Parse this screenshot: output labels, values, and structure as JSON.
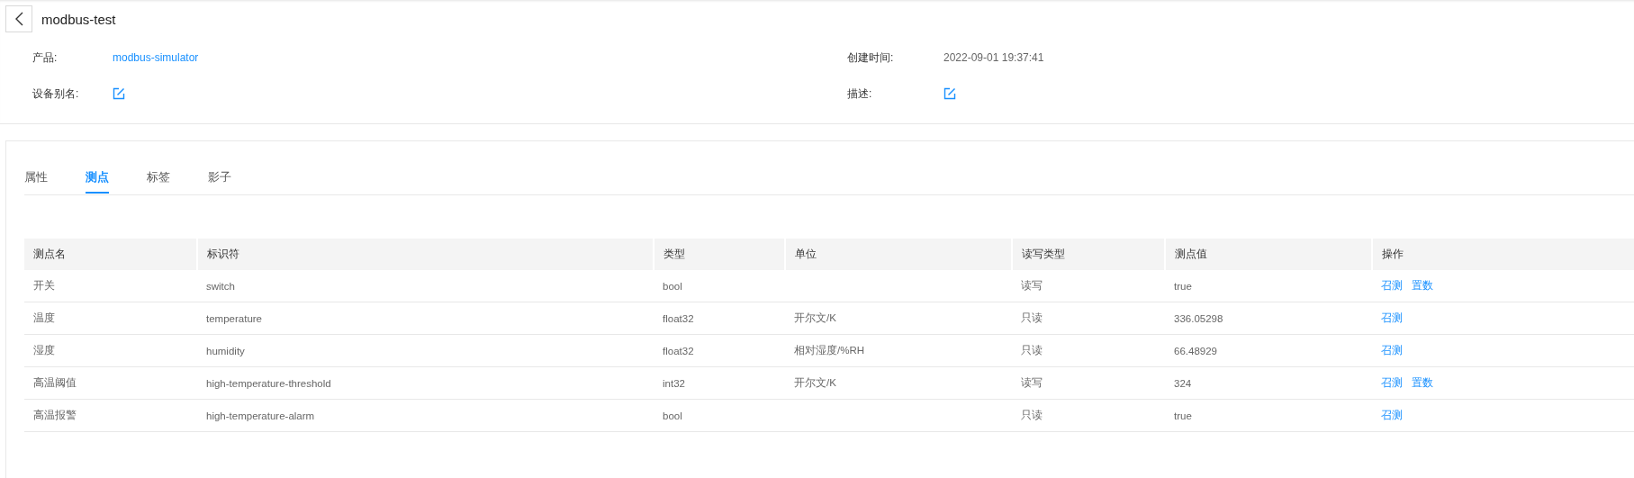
{
  "header": {
    "title": "modbus-test"
  },
  "info": [
    {
      "label": "产品:",
      "kind": "link",
      "value": "modbus-simulator"
    },
    {
      "label": "创建时间:",
      "kind": "text",
      "value": "2022-09-01 19:37:41"
    },
    {
      "label": "设备别名:",
      "kind": "edit"
    },
    {
      "label": "描述:",
      "kind": "edit"
    }
  ],
  "tabs": [
    {
      "label": "属性",
      "selected": false
    },
    {
      "label": "测点",
      "selected": true
    },
    {
      "label": "标签",
      "selected": false
    },
    {
      "label": "影子",
      "selected": false
    }
  ],
  "table": {
    "columns": [
      "测点名",
      "标识符",
      "类型",
      "单位",
      "读写类型",
      "测点值",
      "操作"
    ],
    "rows": [
      {
        "cells": [
          "开关",
          "switch",
          "bool",
          "",
          "读写",
          "true"
        ],
        "actions": [
          "召测",
          "置数"
        ]
      },
      {
        "cells": [
          "温度",
          "temperature",
          "float32",
          "开尔文/K",
          "只读",
          "336.05298"
        ],
        "actions": [
          "召测"
        ]
      },
      {
        "cells": [
          "湿度",
          "humidity",
          "float32",
          "相对湿度/%RH",
          "只读",
          "66.48929"
        ],
        "actions": [
          "召测"
        ]
      },
      {
        "cells": [
          "高温阈值",
          "high-temperature-threshold",
          "int32",
          "开尔文/K",
          "读写",
          "324"
        ],
        "actions": [
          "召测",
          "置数"
        ]
      },
      {
        "cells": [
          "高温报警",
          "high-temperature-alarm",
          "bool",
          "",
          "只读",
          "true"
        ],
        "actions": [
          "召测"
        ]
      }
    ]
  }
}
